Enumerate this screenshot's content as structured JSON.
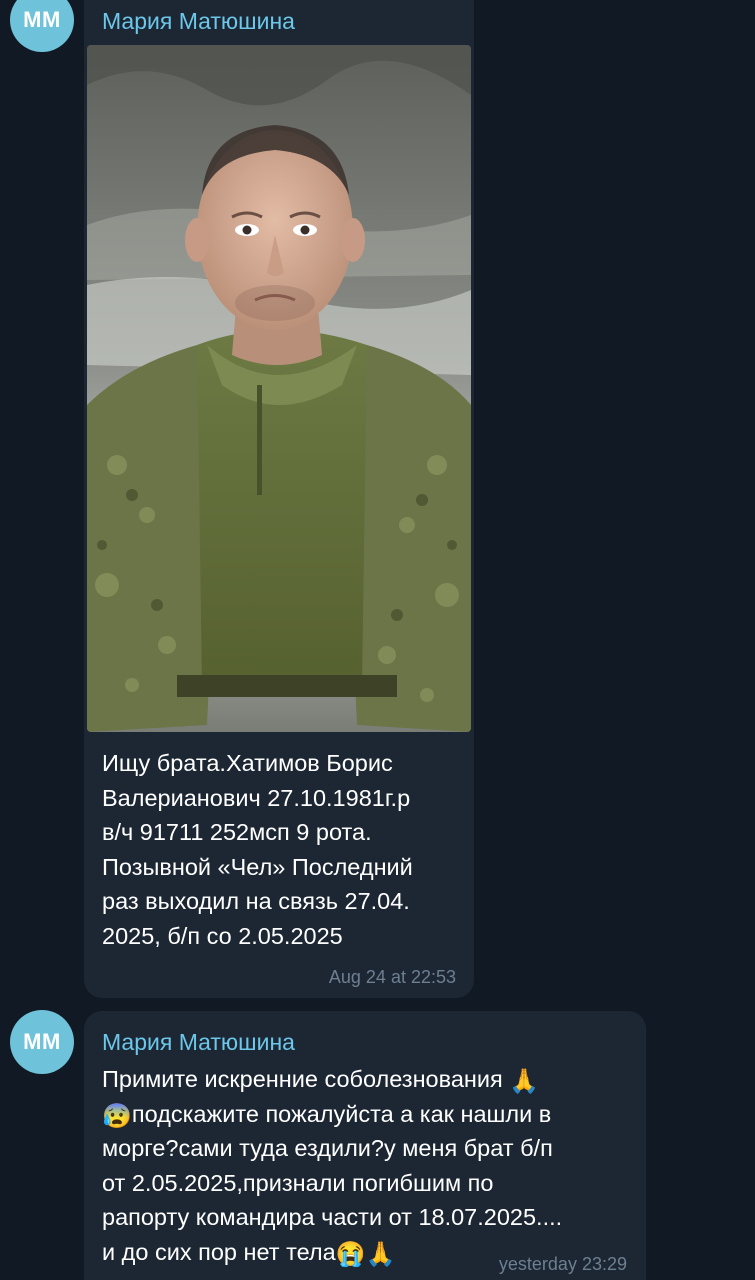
{
  "messages": [
    {
      "avatar_initials": "MM",
      "sender": "Мария Матюшина",
      "image_alt": "Фото мужчины в камуфляжной форме",
      "text_lines": [
        "Ищу брата.Хатимов Борис",
        "Валерианович 27.10.1981г.р",
        "в/ч 91711 252мсп 9 рота.",
        "Позывной «Чел» Последний",
        "раз выходил на связь 27.04.",
        "2025, б/п со 2.05.2025"
      ],
      "time": "Aug 24 at 22:53"
    },
    {
      "avatar_initials": "MM",
      "sender": "Мария Матюшина",
      "line1": "Примите искренние соболезнования",
      "line2": "подскажите пожалуйста а как нашли в",
      "line3": "морге?сами туда ездили?у меня брат б/п",
      "line4": "от 2.05.2025,признали погибшим по",
      "line5": "рапорту командира части от 18.07.2025....",
      "line6": "и до сих пор нет тела",
      "emoji_pray": "🙏",
      "emoji_fear": "😰",
      "emoji_cry": "😭",
      "time": "yesterday 23:29"
    }
  ],
  "colors": {
    "background": "#111a24",
    "bubble": "#1c2733",
    "sender": "#6cc7ea",
    "avatar": "#6ec2d9",
    "time": "#6d7f91"
  }
}
